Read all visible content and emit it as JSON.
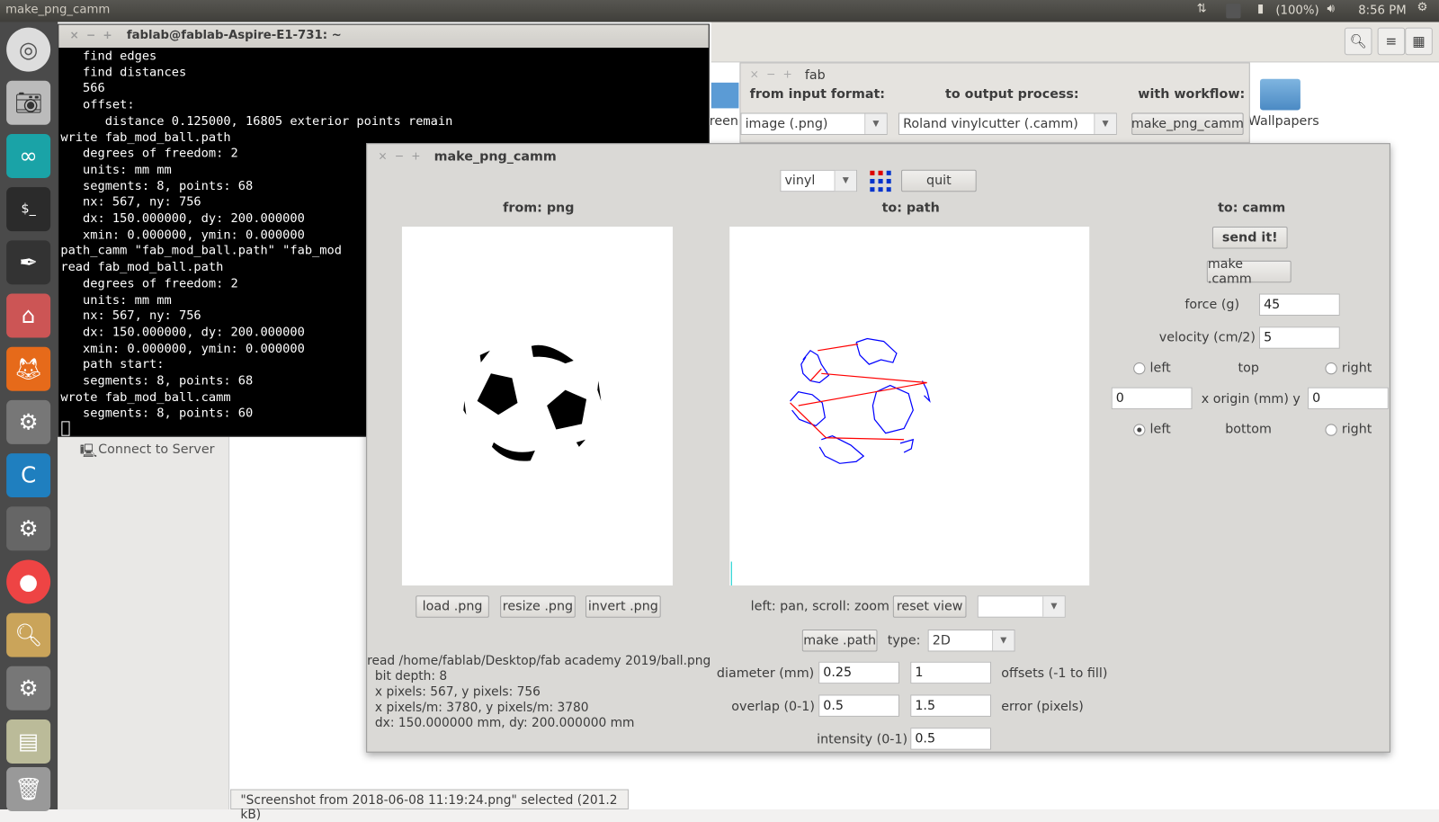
{
  "topbar": {
    "app_title": "make_png_camm",
    "battery": "(100%)",
    "time": "8:56 PM"
  },
  "launcher": {
    "items": [
      "ubuntu-dash",
      "camera",
      "arduino",
      "terminal",
      "inkscape",
      "files",
      "firefox",
      "settings",
      "chromium-c",
      "system-settings",
      "chrome",
      "image-viewer",
      "settings-2",
      "usb-drive",
      "trash"
    ]
  },
  "terminal": {
    "title": "fablab@fablab-Aspire-E1-731: ~",
    "lines": [
      "   find edges",
      "   find distances",
      "   566",
      "   offset:",
      "      distance 0.125000, 16805 exterior points remain",
      "write fab_mod_ball.path",
      "   degrees of freedom: 2",
      "   units: mm mm",
      "   segments: 8, points: 68",
      "   nx: 567, ny: 756",
      "   dx: 150.000000, dy: 200.000000",
      "   xmin: 0.000000, ymin: 0.000000",
      "path_camm \"fab_mod_ball.path\" \"fab_mod",
      "read fab_mod_ball.path",
      "   degrees of freedom: 2",
      "   units: mm mm",
      "   nx: 567, ny: 756",
      "   dx: 150.000000, dy: 200.000000",
      "   xmin: 0.000000, ymin: 0.000000",
      "   path start:",
      "   segments: 8, points: 68",
      "wrote fab_mod_ball.camm",
      "   segments: 8, points: 60"
    ]
  },
  "files": {
    "partial_folder": "reen",
    "folder": "Wallpapers",
    "sidebar_item": "Connect to Server",
    "status": "\"Screenshot from 2018-06-08 11:19:24.png\" selected  (201.2 kB)"
  },
  "fab": {
    "title": "fab",
    "from_label": "from input format:",
    "to_label": "to output process:",
    "workflow_label": "with workflow:",
    "from_value": "image (.png)",
    "to_value": "Roland vinylcutter (.camm)",
    "workflow_button": "make_png_camm"
  },
  "main": {
    "title": "make_png_camm",
    "machine": "vinyl",
    "quit": "quit",
    "from_title": "from: png",
    "to_path_title": "to: path",
    "to_camm_title": "to: camm",
    "load": "load .png",
    "resize": "resize .png",
    "invert": "invert .png",
    "pan_hint": "left: pan, scroll: zoom",
    "reset_view": "reset view",
    "view_select": "",
    "make_path": "make .path",
    "type_label": "type:",
    "type_value": "2D",
    "diameter_label": "diameter (mm)",
    "diameter": "0.25",
    "offsets": "1",
    "offsets_label": "offsets (-1 to fill)",
    "overlap_label": "overlap (0-1)",
    "overlap": "0.5",
    "error": "1.5",
    "error_label": "error (pixels)",
    "intensity_label": "intensity (0-1)",
    "intensity": "0.5",
    "send": "send it!",
    "make_camm": "make .camm",
    "force_label": "force (g)",
    "force": "45",
    "velocity_label": "velocity (cm/2)",
    "velocity": "5",
    "left": "left",
    "top": "top",
    "right": "right",
    "bottom": "bottom",
    "origin_x": "0",
    "origin_label": "x  origin (mm)  y",
    "origin_y": "0",
    "origin_selected": "bottom-left",
    "info": "read /home/fablab/Desktop/fab academy 2019/ball.png\n  bit depth: 8\n  x pixels: 567, y pixels: 756\n  x pixels/m: 3780, y pixels/m: 3780\n  dx: 150.000000 mm, dy: 200.000000 mm"
  },
  "colors": {
    "path": "#0000ff",
    "move": "#ff0000",
    "terminal_bg": "#000000"
  }
}
